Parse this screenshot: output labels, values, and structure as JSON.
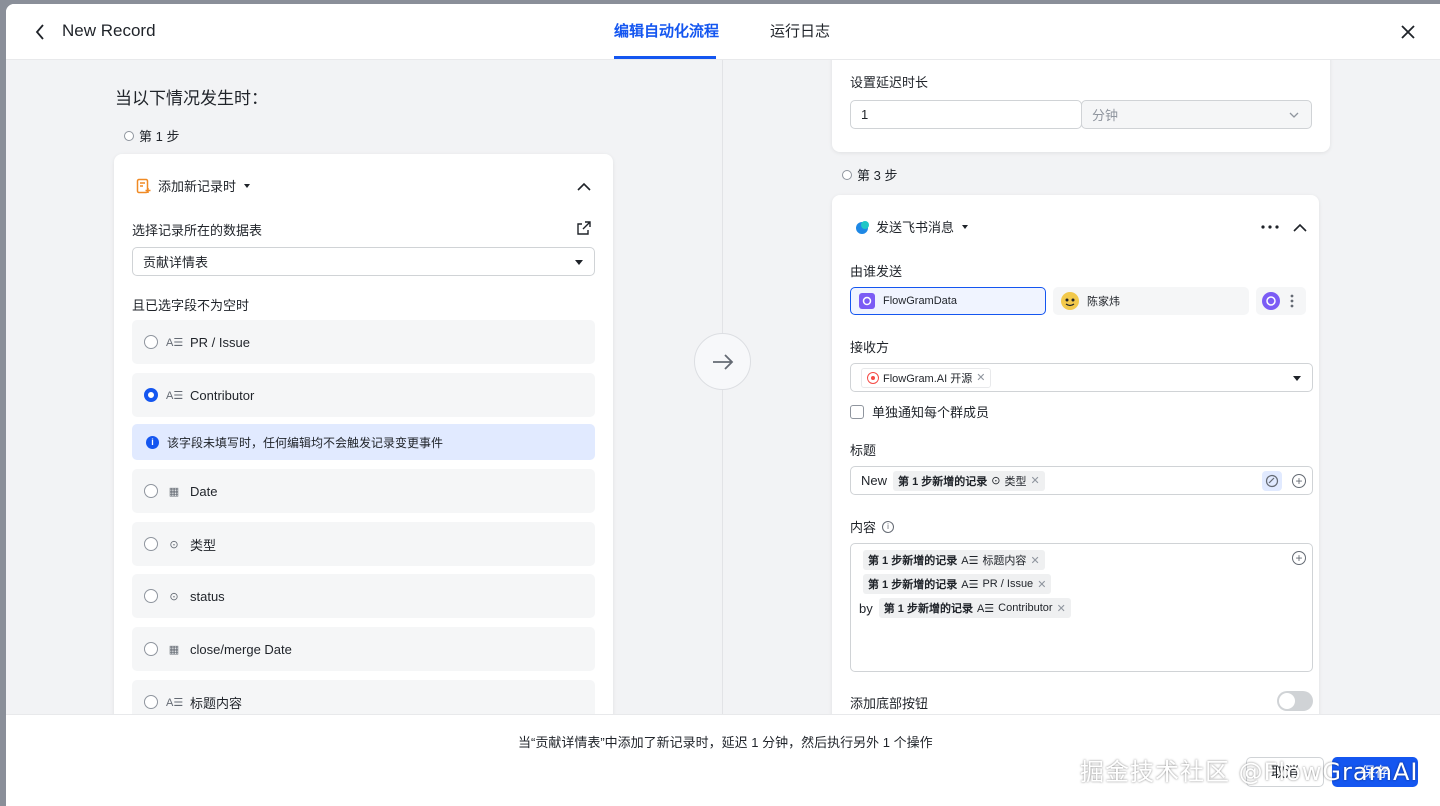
{
  "header": {
    "title": "New Record",
    "tabs": [
      {
        "label": "编辑自动化流程",
        "active": true
      },
      {
        "label": "运行日志",
        "active": false
      }
    ]
  },
  "trigger": {
    "heading": "当以下情况发生时：",
    "step_label": "第 1 步",
    "card_title": "添加新记录时",
    "table_label": "选择记录所在的数据表",
    "table_value": "贡献详情表",
    "fields_label": "且已选字段不为空时",
    "fields": [
      {
        "icon": "A☰",
        "label": "PR / Issue",
        "selected": false
      },
      {
        "icon": "A☰",
        "label": "Contributor",
        "selected": true
      },
      {
        "icon": "▦",
        "label": "Date",
        "selected": false
      },
      {
        "icon": "⊙",
        "label": "类型",
        "selected": false
      },
      {
        "icon": "⊙",
        "label": "status",
        "selected": false
      },
      {
        "icon": "▦",
        "label": "close/merge Date",
        "selected": false
      },
      {
        "icon": "A☰",
        "label": "标题内容",
        "selected": false
      }
    ],
    "info_text": "该字段未填写时，任何编辑均不会触发记录变更事件"
  },
  "delay": {
    "label": "设置延迟时长",
    "value": "1",
    "unit": "分钟"
  },
  "action": {
    "step_label": "第 3 步",
    "card_title": "发送飞书消息",
    "sender_label": "由谁发送",
    "sender_bot": "FlowGramData",
    "sender_user": "陈家炜",
    "receiver_label": "接收方",
    "receiver_chip": "FlowGram.AI 开源",
    "notify_each": "单独通知每个群成员",
    "title_label": "标题",
    "title_prefix": "New",
    "ref_record": "第 1 步新增的记录",
    "title_field": "类型",
    "content_label": "内容",
    "content_lines": [
      {
        "prefix": "",
        "field": "标题内容"
      },
      {
        "prefix": "",
        "field": "PR / Issue"
      },
      {
        "prefix": "by",
        "field": "Contributor"
      }
    ],
    "bottom_button_label": "添加底部按钮"
  },
  "footer": {
    "summary": "当“贡献详情表”中添加了新记录时，延迟 1 分钟，然后执行另外 1 个操作",
    "cancel": "取消",
    "confirm": "保存"
  },
  "watermark": "掘金技术社区 @FlowGramAI",
  "colors": {
    "accent": "#1456f0",
    "info_bg": "#e1eaff",
    "bot_purple": "#7b5cf5"
  }
}
